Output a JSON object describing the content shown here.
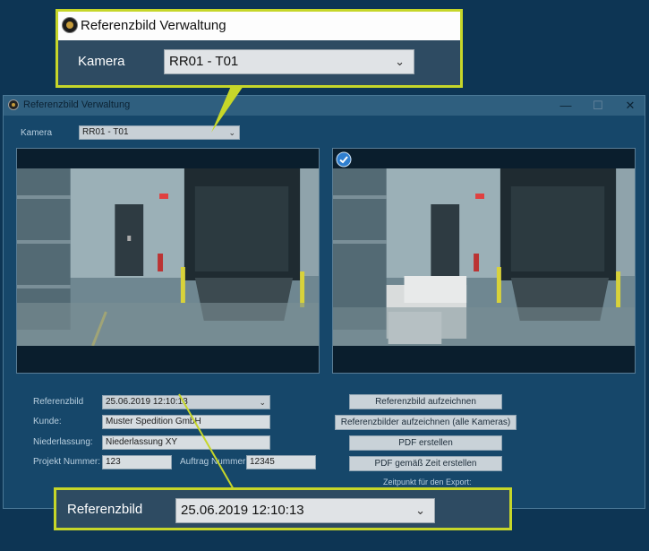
{
  "window": {
    "title": "Referenzbild Verwaltung",
    "minimize": "—",
    "maximize": "☐",
    "close": "✕"
  },
  "camera": {
    "label": "Kamera",
    "selected": "RR01 - T01"
  },
  "form": {
    "referenzbild_label": "Referenzbild",
    "referenzbild_value": "25.06.2019 12:10:13",
    "kunde_label": "Kunde:",
    "kunde_value": "Muster Spedition GmbH",
    "niederlassung_label": "Niederlassung:",
    "niederlassung_value": "Niederlassung XY",
    "projekt_label": "Projekt Nummer:",
    "projekt_value": "123",
    "auftrag_label": "Auftrag Nummer:",
    "auftrag_value": "12345"
  },
  "buttons": {
    "record": "Referenzbild aufzeichnen",
    "record_all": "Referenzbilder aufzeichnen (alle Kameras)",
    "pdf": "PDF erstellen",
    "pdf_time": "PDF gemäß Zeit erstellen"
  },
  "export_label": "Zeitpunkt für den Export:",
  "colors": {
    "accent": "#c6d629",
    "window_bg": "#16476a",
    "page_bg": "#0d3554",
    "check_badge": "#2f7fd0"
  },
  "icons": {
    "app": "camera-app-icon",
    "check": "check-badge-icon",
    "dropdown": "chevron-down-icon"
  }
}
